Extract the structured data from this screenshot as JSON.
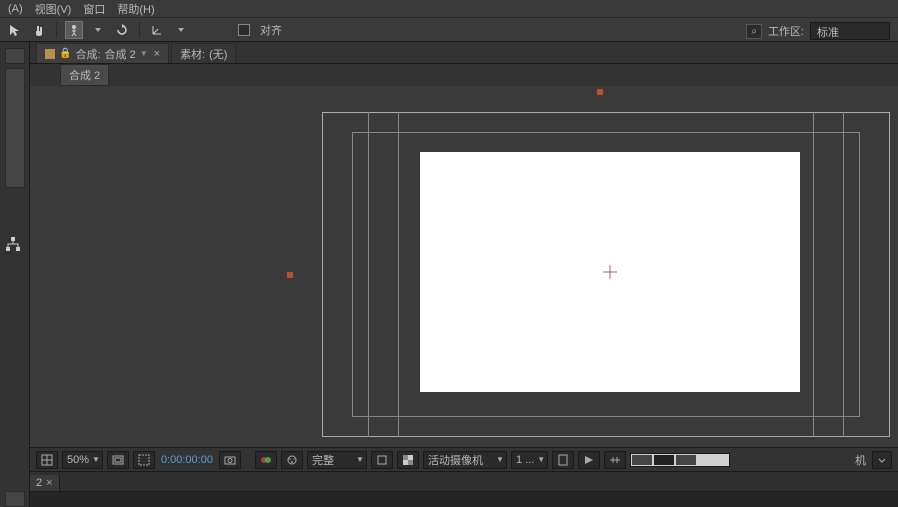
{
  "menu": {
    "a": "(A)",
    "view": "视图(V)",
    "window": "窗口",
    "help": "帮助(H)"
  },
  "toolbar": {
    "align_label": "对齐",
    "workspace_label": "工作区:",
    "workspace_value": "标准",
    "search_label": "⌕"
  },
  "tabs": {
    "comp_prefix": "合成:",
    "comp_name": "合成 2",
    "material_label": "素材:",
    "material_value": "(无)",
    "subtab": "合成 2"
  },
  "footer": {
    "zoom": "50%",
    "timecode": "0:00:00:00",
    "quality": "完整",
    "camera": "活动摄像机",
    "one": "1 ...",
    "machine": "机"
  },
  "bottom_tab": "2"
}
